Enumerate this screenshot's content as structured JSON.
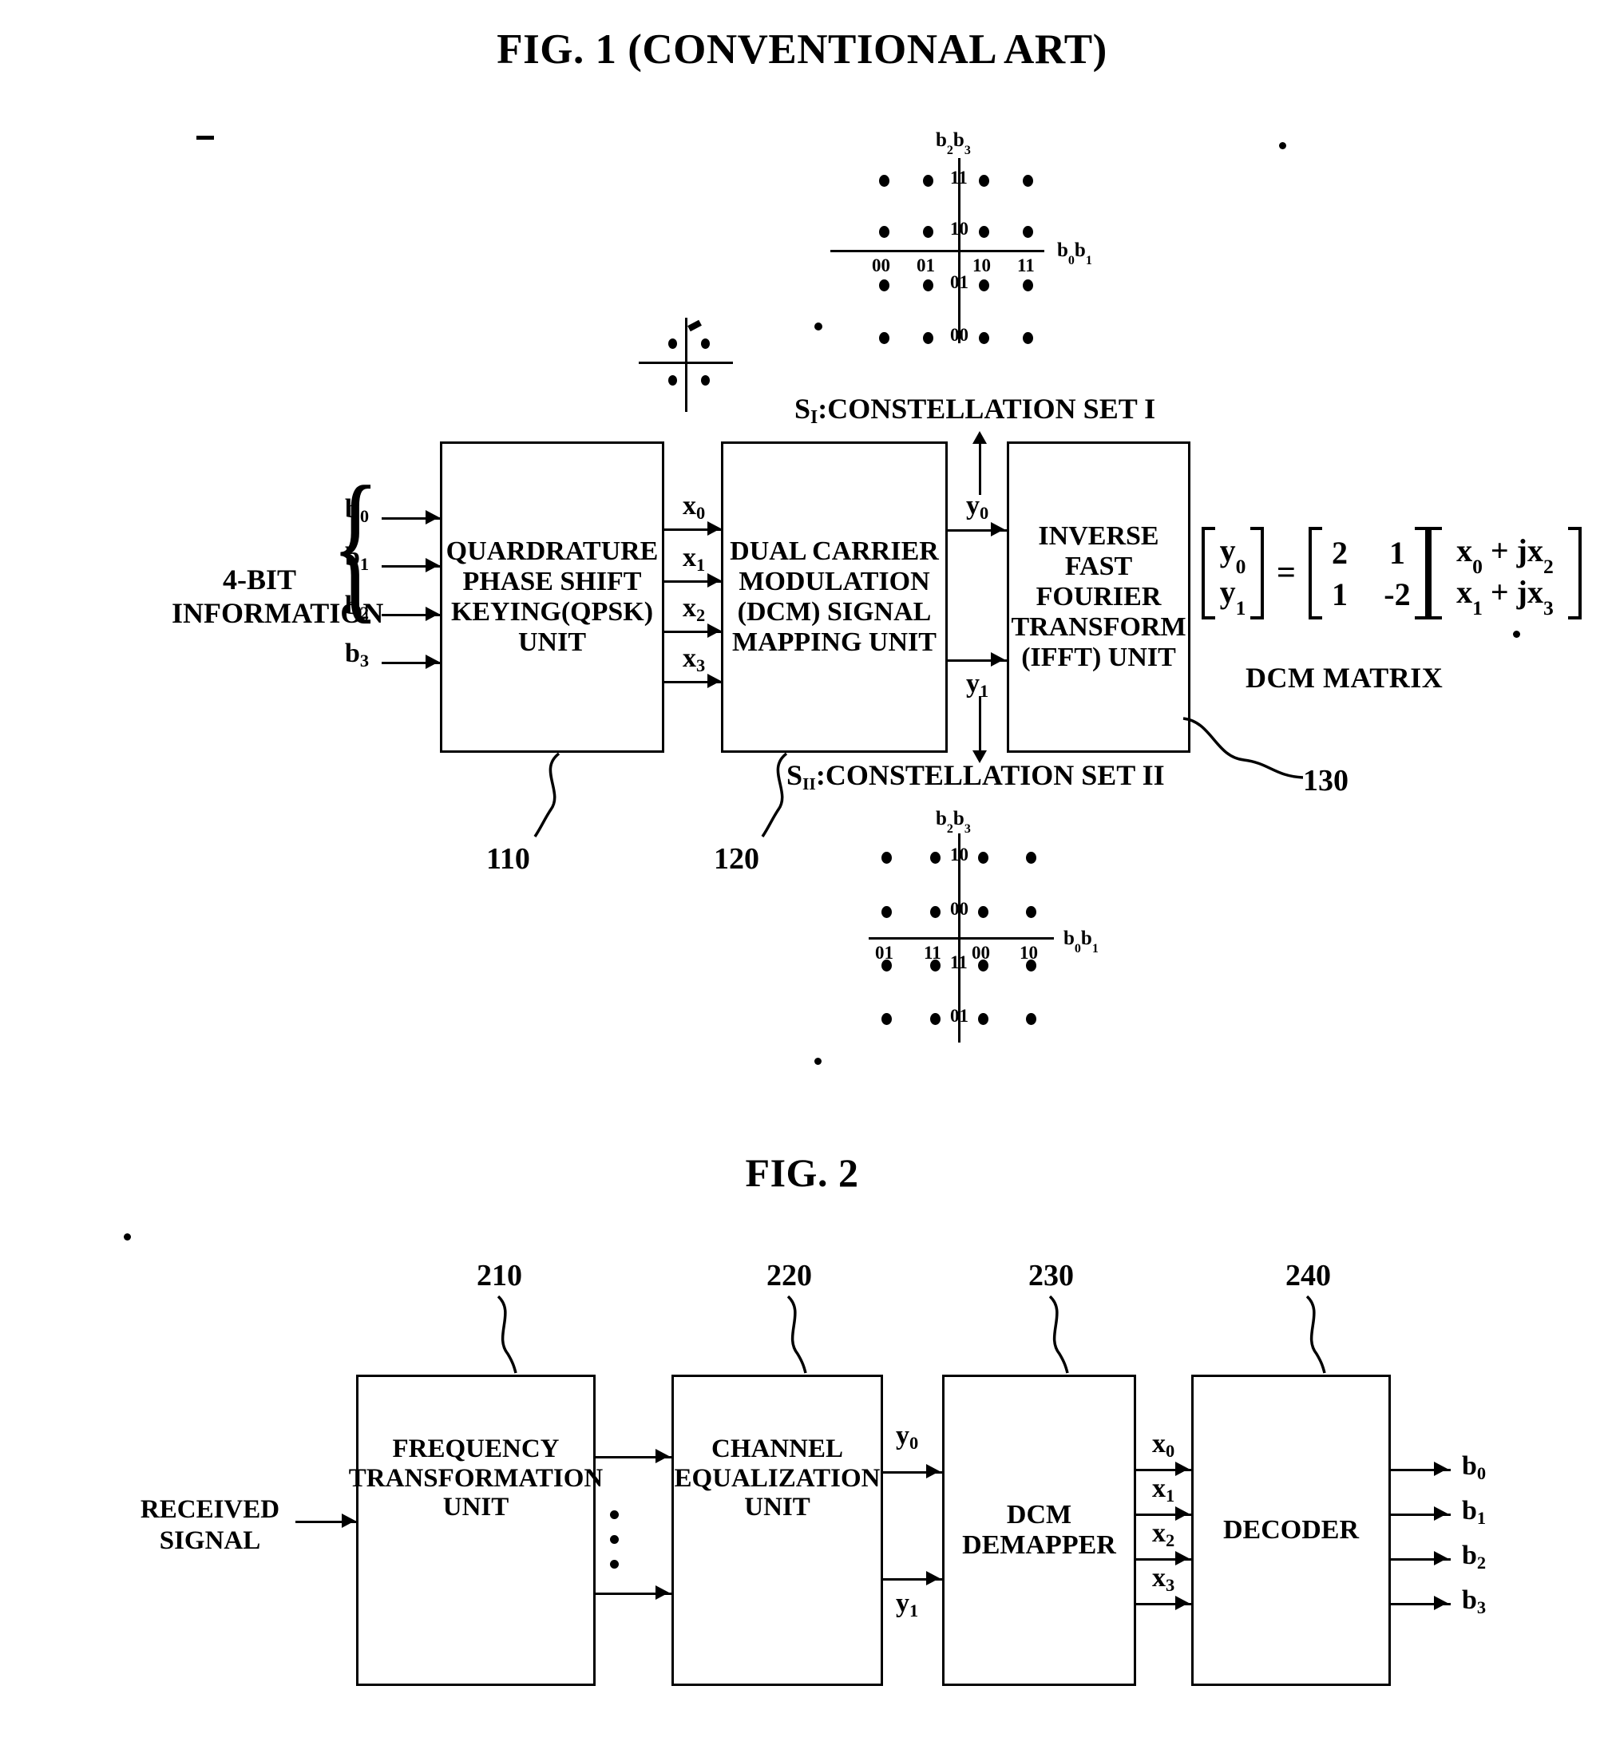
{
  "figures": {
    "fig1": {
      "title": "FIG. 1 (CONVENTIONAL ART)",
      "input_label": "4-BIT\nINFORMATION",
      "input_bits": [
        "b",
        "b",
        "b",
        "b"
      ],
      "input_bit_subs": [
        "0",
        "1",
        "2",
        "3"
      ],
      "blocks": [
        {
          "ref": "110",
          "label": "QUARDRATURE\nPHASE SHIFT\nKEYING(QPSK)\nUNIT"
        },
        {
          "ref": "120",
          "label": "DUAL CARRIER\nMODULATION\n(DCM) SIGNAL\nMAPPING UNIT"
        },
        {
          "ref": "130",
          "label": "INVERSE\nFAST\nFOURIER\nTRANSFORM\n(IFFT) UNIT"
        }
      ],
      "x_signals": [
        {
          "base": "x",
          "sub": "0"
        },
        {
          "base": "x",
          "sub": "1"
        },
        {
          "base": "x",
          "sub": "2"
        },
        {
          "base": "x",
          "sub": "3"
        }
      ],
      "y_signals": [
        {
          "base": "y",
          "sub": "0"
        },
        {
          "base": "y",
          "sub": "1"
        }
      ],
      "equation": {
        "lhs": [
          {
            "base": "y",
            "sub": "0"
          },
          {
            "base": "y",
            "sub": "1"
          }
        ],
        "equals": "=",
        "matrix": [
          [
            "2",
            "1"
          ],
          [
            "1",
            "-2"
          ]
        ],
        "rhs": [
          {
            "a": "x",
            "asub": "0",
            "op": "+ j",
            "b": "x",
            "bsub": "2"
          },
          {
            "a": "x",
            "asub": "1",
            "op": "+ j",
            "b": "x",
            "bsub": "3"
          }
        ],
        "caption": "DCM MATRIX"
      },
      "constellation_set_1": {
        "caption_prefix": "S",
        "caption_sub": "I",
        "caption": ":CONSTELLATION SET I",
        "y_axis_label": {
          "b": "b",
          "s1": "2",
          "s2": "3"
        },
        "x_axis_label": {
          "b": "b",
          "s1": "0",
          "s2": "1"
        },
        "row_labels": [
          "11",
          "10",
          "01",
          "00"
        ],
        "col_labels": [
          "00",
          "01",
          "10",
          "11"
        ]
      },
      "constellation_set_2": {
        "caption_prefix": "S",
        "caption_sub": "II",
        "caption": ":CONSTELLATION SET II",
        "y_axis_label": {
          "b": "b",
          "s1": "2",
          "s2": "3"
        },
        "x_axis_label": {
          "b": "b",
          "s1": "0",
          "s2": "1"
        },
        "row_labels": [
          "10",
          "00",
          "11",
          "01"
        ],
        "col_labels": [
          "01",
          "11",
          "00",
          "10"
        ]
      },
      "qpsk_mini_constellation": {
        "points": 4
      }
    },
    "fig2": {
      "title": "FIG. 2",
      "input_label": "RECEIVED\nSIGNAL",
      "blocks": [
        {
          "ref": "210",
          "label": "FREQUENCY\nTRANSFORMATION\nUNIT"
        },
        {
          "ref": "220",
          "label": "CHANNEL\nEQUALIZATION\nUNIT"
        },
        {
          "ref": "230",
          "label": "DCM\nDEMAPPER"
        },
        {
          "ref": "240",
          "label": "DECODER"
        }
      ],
      "y_signals": [
        {
          "base": "y",
          "sub": "0"
        },
        {
          "base": "y",
          "sub": "1"
        }
      ],
      "x_signals": [
        {
          "base": "x",
          "sub": "0"
        },
        {
          "base": "x",
          "sub": "1"
        },
        {
          "base": "x",
          "sub": "2"
        },
        {
          "base": "x",
          "sub": "3"
        }
      ],
      "b_outputs": [
        {
          "base": "b",
          "sub": "0"
        },
        {
          "base": "b",
          "sub": "1"
        },
        {
          "base": "b",
          "sub": "2"
        },
        {
          "base": "b",
          "sub": "3"
        }
      ]
    }
  },
  "colors": {
    "ink": "#000000",
    "paper": "#ffffff"
  }
}
